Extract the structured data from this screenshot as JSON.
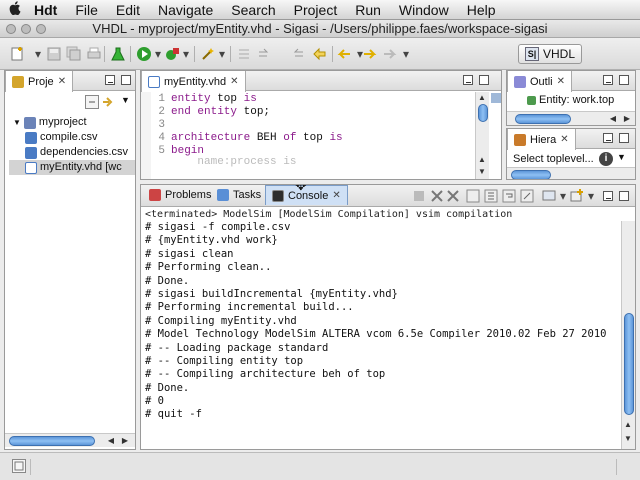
{
  "menubar": {
    "app": "Hdt",
    "items": [
      "File",
      "Edit",
      "Navigate",
      "Search",
      "Project",
      "Run",
      "Window",
      "Help"
    ]
  },
  "window": {
    "title": "VHDL - myproject/myEntity.vhd - Sigasi - /Users/philippe.faes/workspace-sigasi"
  },
  "toolbar": {
    "perspective_label": "VHDL",
    "perspective_icon": "S|"
  },
  "project_explorer": {
    "tab_label": "Proje",
    "tree": [
      {
        "label": "myproject",
        "level": 0,
        "icon": "project-folder-icon",
        "expanded": true
      },
      {
        "label": "compile.csv",
        "level": 1,
        "icon": "csv-file-icon"
      },
      {
        "label": "dependencies.csv",
        "level": 1,
        "icon": "csv-file-icon"
      },
      {
        "label": "myEntity.vhd [wc",
        "level": 1,
        "icon": "vhdl-file-icon",
        "selected": true
      }
    ]
  },
  "editor": {
    "tab_label": "myEntity.vhd",
    "lines": [
      {
        "num": "1",
        "parts": [
          [
            "kw",
            "entity"
          ],
          [
            "plain",
            " top "
          ],
          [
            "kw",
            "is"
          ]
        ]
      },
      {
        "num": "2",
        "parts": [
          [
            "kw",
            "end entity"
          ],
          [
            "plain",
            " top;"
          ]
        ]
      },
      {
        "num": "3",
        "parts": [
          [
            "plain",
            ""
          ]
        ]
      },
      {
        "num": "4",
        "parts": [
          [
            "kw",
            "architecture"
          ],
          [
            "plain",
            " BEH "
          ],
          [
            "kw",
            "of"
          ],
          [
            "plain",
            " top "
          ],
          [
            "kw",
            "is"
          ]
        ]
      },
      {
        "num": "5",
        "parts": [
          [
            "kw",
            "begin"
          ]
        ]
      },
      {
        "num": "",
        "parts": [
          [
            "plain",
            "    name:process is"
          ]
        ]
      }
    ]
  },
  "outline": {
    "tab_label": "Outli",
    "item": "Entity: work.top"
  },
  "hierarchy": {
    "tab_label": "Hiera",
    "item": "Select toplevel..."
  },
  "bottom_tabs": {
    "problems": "Problems",
    "tasks": "Tasks",
    "console": "Console"
  },
  "console": {
    "header": "<terminated> ModelSim [ModelSim Compilation] vsim compilation",
    "lines": [
      "# sigasi -f compile.csv",
      "# {myEntity.vhd work}",
      "# sigasi clean",
      "# Performing clean..",
      "# Done.",
      "# sigasi buildIncremental {myEntity.vhd}",
      "# Performing incremental build...",
      "# Compiling myEntity.vhd",
      "# Model Technology ModelSim ALTERA vcom 6.5e Compiler 2010.02 Feb 27 2010",
      "# -- Loading package standard",
      "# -- Compiling entity top",
      "# -- Compiling architecture beh of top",
      "# Done.",
      "# 0",
      "# quit -f"
    ]
  },
  "colors": {
    "keyword": "#8b1a8b",
    "scroll_thumb": "#6aa4e6",
    "selection": "#d3d3d3"
  }
}
